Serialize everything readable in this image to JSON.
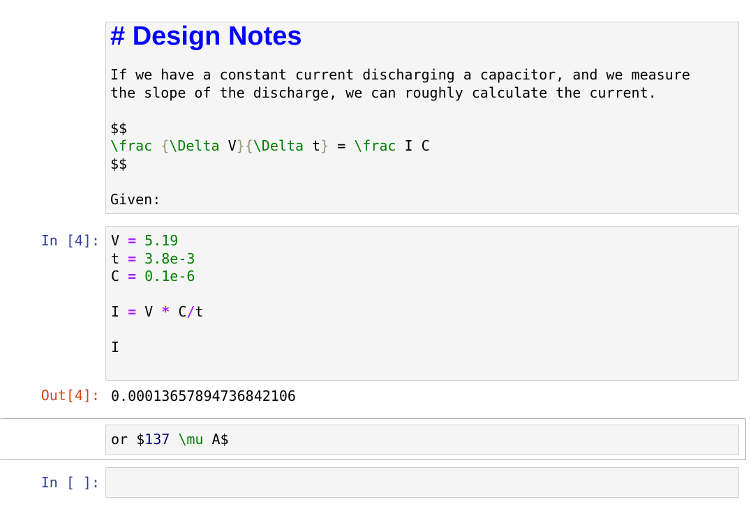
{
  "markdown_cell_1": {
    "heading": "# Design Notes",
    "paragraph_line_1": "If we have a constant current discharging a capacitor, and we measure",
    "paragraph_line_2": "the slope of the discharge, we can roughly calculate the current.",
    "math_open": "$$",
    "math_frac_cmd": "\\frac",
    "math_brace_open_1": "{",
    "math_delta_1": "\\Delta",
    "math_v": " V",
    "math_brace_close_open": "}{",
    "math_delta_2": "\\Delta",
    "math_t": " t",
    "math_brace_close_2": "}",
    "math_equals": " = ",
    "math_frac_cmd_2": "\\frac",
    "math_ic": " I C",
    "math_close": "$$",
    "given": "Given:"
  },
  "code_cell_1": {
    "prompt": "In [4]:",
    "line_1": {
      "var": "V ",
      "op": "=",
      "val": " 5.19"
    },
    "line_2": {
      "var": "t ",
      "op": "=",
      "val": " 3.8e-3"
    },
    "line_3": {
      "var": "C ",
      "op": "=",
      "val": " 0.1e-6"
    },
    "line_5": {
      "var": "I ",
      "op1": "=",
      "mid": " V ",
      "op2": "*",
      "mid2": " C",
      "op3": "/",
      "end": "t"
    },
    "line_7": "I"
  },
  "output_1": {
    "prompt": "Out[4]:",
    "value": "0.00013657894736842106"
  },
  "markdown_cell_2": {
    "prefix": "or $",
    "number": "137",
    "space": " ",
    "mu": "\\mu",
    "suffix": " A$"
  },
  "code_cell_2": {
    "prompt": "In [ ]:",
    "content": ""
  }
}
